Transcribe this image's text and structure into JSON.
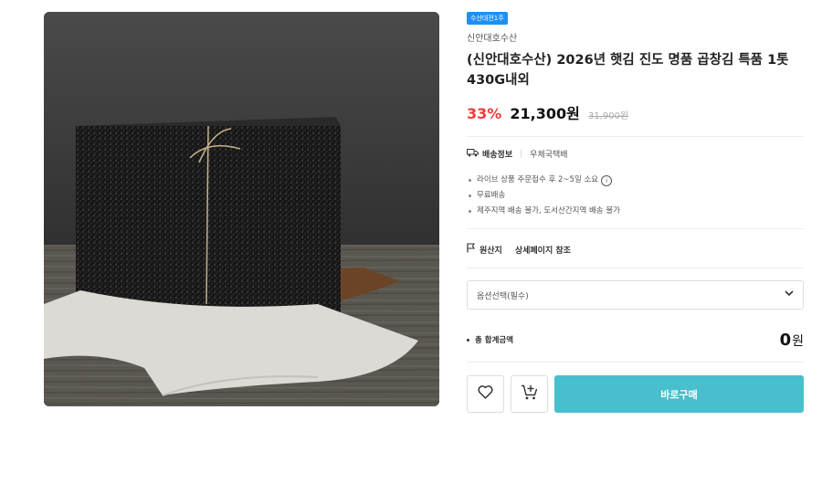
{
  "product": {
    "badge": "수산대전1주",
    "brand": "신안대호수산",
    "title": "(신안대호수산) 2026년 햇김 진도 명품 곱창김 특품 1톳 430G내외",
    "discount": "33%",
    "price": "21,300원",
    "original_price": "31,900원"
  },
  "shipping": {
    "label": "배송정보",
    "value": "우체국택배",
    "notes": [
      "라이브 상품 주문접수 후 2~5일 소요",
      "무료배송",
      "제주지역 배송 불가, 도서산간지역 배송 불가"
    ]
  },
  "origin": {
    "label": "원산지",
    "value": "상세페이지 참조"
  },
  "option_select": {
    "placeholder": "옵션선택(필수)"
  },
  "total": {
    "label": "총 합계금액",
    "amount": "0",
    "unit": "원"
  },
  "actions": {
    "buy_label": "바로구매"
  },
  "colors": {
    "accent": "#47bfcd",
    "discount": "#ef3b3b",
    "badge": "#1f8ff0"
  }
}
